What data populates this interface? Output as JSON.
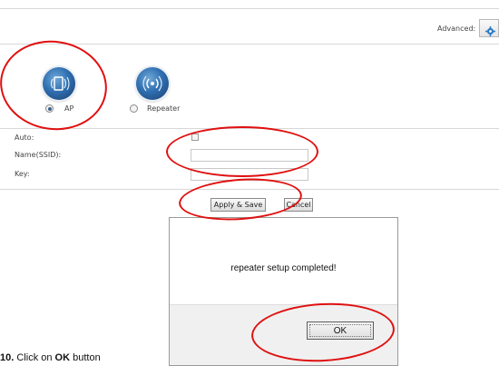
{
  "header": {
    "advanced_label": "Advanced:",
    "advanced_icon": "gear-icon"
  },
  "modes": [
    {
      "label": "AP",
      "icon": "access-point-icon",
      "selected": true
    },
    {
      "label": "Repeater",
      "icon": "repeater-icon",
      "selected": false
    }
  ],
  "form": {
    "auto_label": "Auto:",
    "auto_checked": false,
    "ssid_label": "Name(SSID):",
    "ssid_value": "",
    "key_label": "Key:",
    "key_value": ""
  },
  "actions": {
    "apply_label": "Apply & Save",
    "cancel_label": "Cancel"
  },
  "dialog": {
    "message": "repeater setup completed!",
    "ok_label": "OK"
  },
  "caption": {
    "step_number": "10.",
    "text_before": "Click on",
    "bold_text": "OK",
    "text_after": "button"
  },
  "colors": {
    "annotation": "#e01010",
    "icon_blue": "#2f6fb1"
  }
}
